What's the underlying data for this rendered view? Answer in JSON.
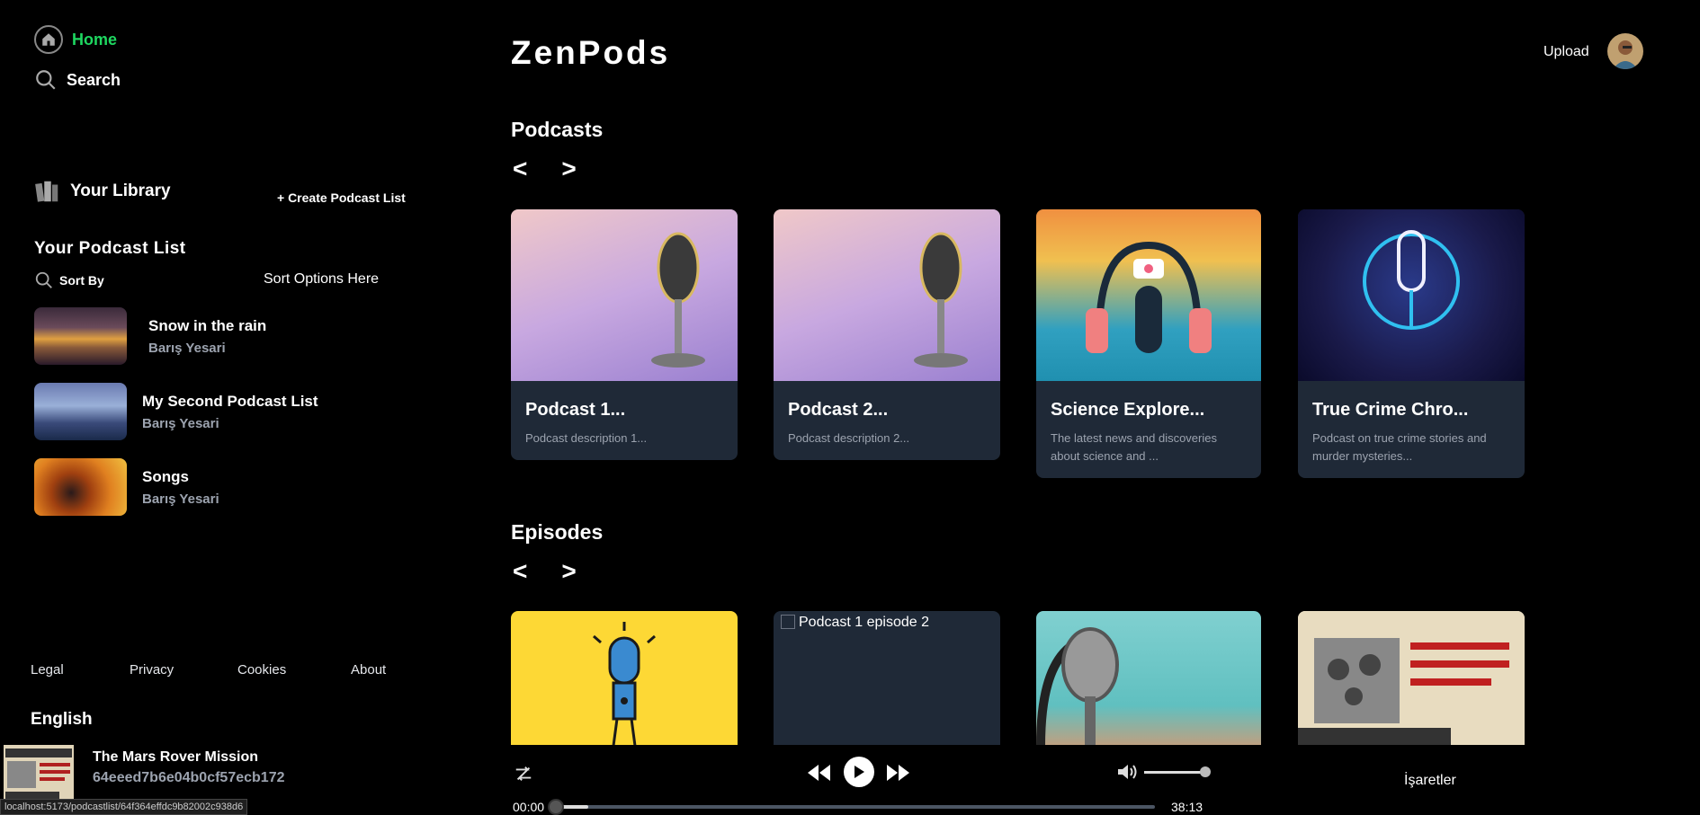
{
  "sidebar": {
    "home_label": "Home",
    "search_label": "Search",
    "library_label": "Your Library",
    "create_label": "+ Create Podcast List",
    "list_title": "Your Podcast List",
    "sort_by_label": "Sort By",
    "sort_options_label": "Sort Options Here",
    "playlists": [
      {
        "name": "Snow in the rain",
        "author": "Barış Yesari"
      },
      {
        "name": "My Second Podcast List",
        "author": "Barış Yesari"
      },
      {
        "name": "Songs",
        "author": "Barış Yesari"
      }
    ],
    "footer_links": [
      "Legal",
      "Privacy",
      "Cookies",
      "About"
    ],
    "language": "English"
  },
  "header": {
    "logo": "ZenPods",
    "upload_label": "Upload"
  },
  "podcasts": {
    "title": "Podcasts",
    "prev": "<",
    "next": ">",
    "items": [
      {
        "title": "Podcast 1...",
        "desc": "Podcast description 1..."
      },
      {
        "title": "Podcast 2...",
        "desc": "Podcast description 2..."
      },
      {
        "title": "Science Explore...",
        "desc": "The latest news and discoveries about science and ..."
      },
      {
        "title": "True Crime Chro...",
        "desc": "Podcast on true crime stories and murder mysteries..."
      }
    ]
  },
  "episodes": {
    "title": "Episodes",
    "prev": "<",
    "next": ">",
    "broken_alt": "Podcast 1 episode 2"
  },
  "player": {
    "title": "The Mars Rover Mission",
    "subtitle": "64eeed7b6e04b0cf57ecb172",
    "time_current": "00:00",
    "time_total": "38:13",
    "progress": 0.0,
    "volume": 0.85,
    "markers_label": "İşaretler"
  },
  "status_url": "localhost:5173/podcastlist/64f364effdc9b82002c938d6",
  "colors": {
    "accent": "#1ed760",
    "card_bg": "#1f2937",
    "muted_text": "#9ca3af"
  }
}
